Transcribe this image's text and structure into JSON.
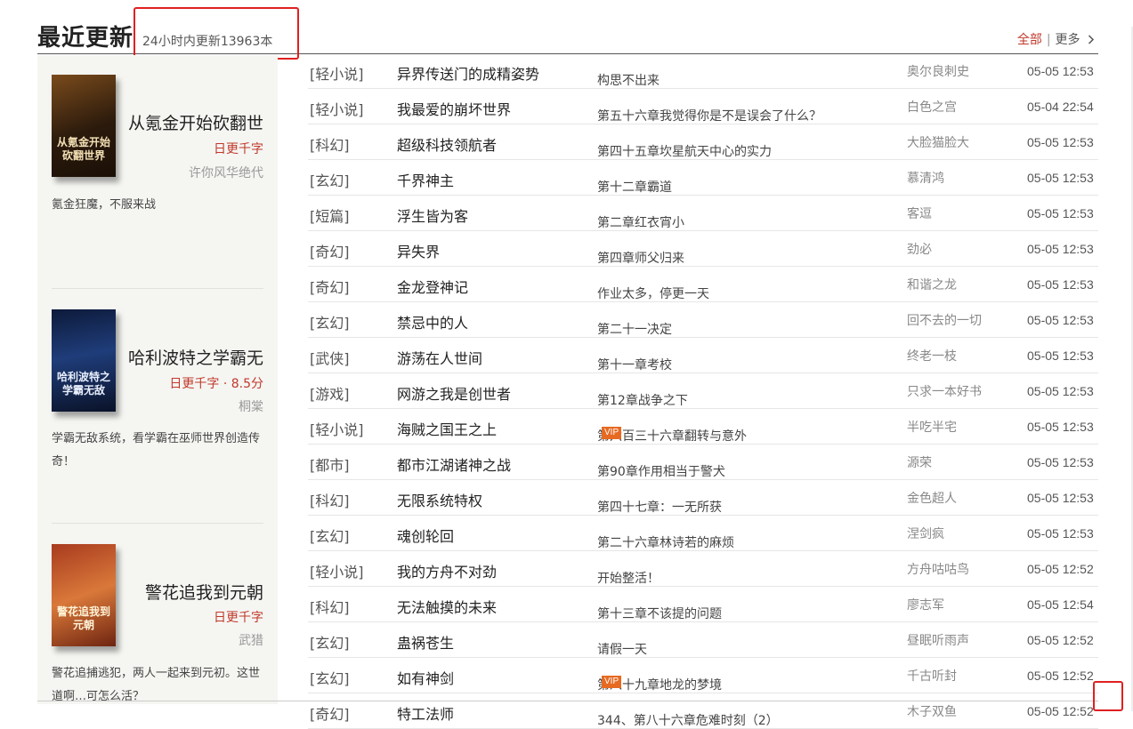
{
  "header": {
    "title": "最近更新",
    "subtitle": "24小时内更新13963本",
    "all_label": "全部",
    "more_label": "更多",
    "more_icon": "chevron-right-icon"
  },
  "sidebar": {
    "books": [
      {
        "cover_text": "从氪金开始砍翻世界",
        "title": "从氪金开始砍翻世",
        "tag": "日更千字",
        "author": "许你风华绝代",
        "desc": "氪金狂魔，不服来战"
      },
      {
        "cover_text": "哈利波特之学霸无敌",
        "title": "哈利波特之学霸无",
        "tag": "日更千字 · 8.5分",
        "author": "桐棠",
        "desc": "学霸无敌系统，看学霸在巫师世界创造传奇！"
      },
      {
        "cover_text": "警花追我到元朝",
        "title": "警花追我到元朝",
        "tag": "日更千字",
        "author": "武猎",
        "desc": "警花追捕逃犯，两人一起来到元初。这世道啊…可怎么活？"
      }
    ]
  },
  "list": {
    "rows": [
      {
        "cat": "[轻小说]",
        "name": "异界传送门的成精姿势",
        "chapter": "构思不出来",
        "vip": "",
        "author": "奥尔良刺史",
        "time": "05-05 12:53"
      },
      {
        "cat": "[轻小说]",
        "name": "我最爱的崩坏世界",
        "chapter": "第五十六章我觉得你是不是误会了什么？",
        "vip": "",
        "author": "白色之宫",
        "time": "05-04 22:54"
      },
      {
        "cat": "[科幻]",
        "name": "超级科技领航者",
        "chapter": "第四十五章坎星航天中心的实力",
        "vip": "",
        "author": "大脸猫脸大",
        "time": "05-05 12:53"
      },
      {
        "cat": "[玄幻]",
        "name": "千界神主",
        "chapter": "第十二章霸道",
        "vip": "",
        "author": "慕清鸿",
        "time": "05-05 12:53"
      },
      {
        "cat": "[短篇]",
        "name": "浮生皆为客",
        "chapter": "第二章红衣宵小",
        "vip": "",
        "author": "客逗",
        "time": "05-05 12:53"
      },
      {
        "cat": "[奇幻]",
        "name": "异失界",
        "chapter": "第四章师父归来",
        "vip": "",
        "author": "劲必",
        "time": "05-05 12:53"
      },
      {
        "cat": "[奇幻]",
        "name": "金龙登神记",
        "chapter": "作业太多，停更一天",
        "vip": "",
        "author": "和谐之龙",
        "time": "05-05 12:53"
      },
      {
        "cat": "[玄幻]",
        "name": "禁忌中的人",
        "chapter": "第二十一决定",
        "vip": "",
        "author": "回不去的一切",
        "time": "05-05 12:53"
      },
      {
        "cat": "[武侠]",
        "name": "游荡在人世间",
        "chapter": "第十一章考校",
        "vip": "",
        "author": "终老一枝",
        "time": "05-05 12:53"
      },
      {
        "cat": "[游戏]",
        "name": "网游之我是创世者",
        "chapter": "第12章战争之下",
        "vip": "",
        "author": "只求一本好书",
        "time": "05-05 12:53"
      },
      {
        "cat": "[轻小说]",
        "name": "海贼之国王之上",
        "chapter": "第六百三十六章翻转与意外",
        "vip": "VIP",
        "author": "半吃半宅",
        "time": "05-05 12:53"
      },
      {
        "cat": "[都市]",
        "name": "都市江湖诸神之战",
        "chapter": "第90章作用相当于警犬",
        "vip": "",
        "author": "源荣",
        "time": "05-05 12:53"
      },
      {
        "cat": "[科幻]",
        "name": "无限系统特权",
        "chapter": "第四十七章：一无所获",
        "vip": "",
        "author": "金色超人",
        "time": "05-05 12:53"
      },
      {
        "cat": "[玄幻]",
        "name": "魂创轮回",
        "chapter": "第二十六章林诗若的麻烦",
        "vip": "",
        "author": "涅剑疯",
        "time": "05-05 12:53"
      },
      {
        "cat": "[轻小说]",
        "name": "我的方舟不对劲",
        "chapter": "开始整活！",
        "vip": "",
        "author": "方舟咕咕鸟",
        "time": "05-05 12:52"
      },
      {
        "cat": "[科幻]",
        "name": "无法触摸的未来",
        "chapter": "第十三章不该提的问题",
        "vip": "",
        "author": "廖志军",
        "time": "05-05 12:54"
      },
      {
        "cat": "[玄幻]",
        "name": "蛊祸苍生",
        "chapter": "请假一天",
        "vip": "",
        "author": "昼眠听雨声",
        "time": "05-05 12:52"
      },
      {
        "cat": "[玄幻]",
        "name": "如有神剑",
        "chapter": "第八十九章地龙的梦境",
        "vip": "VIP",
        "author": "千古听封",
        "time": "05-05 12:52"
      },
      {
        "cat": "[奇幻]",
        "name": "特工法师",
        "chapter": "344、第八十六章危难时刻（2）",
        "vip": "",
        "author": "木子双鱼",
        "time": "05-05 12:52"
      }
    ]
  },
  "colors": {
    "accent_red": "#c0392b",
    "vip_orange": "#e66a22",
    "annotation_red": "#e02020"
  }
}
